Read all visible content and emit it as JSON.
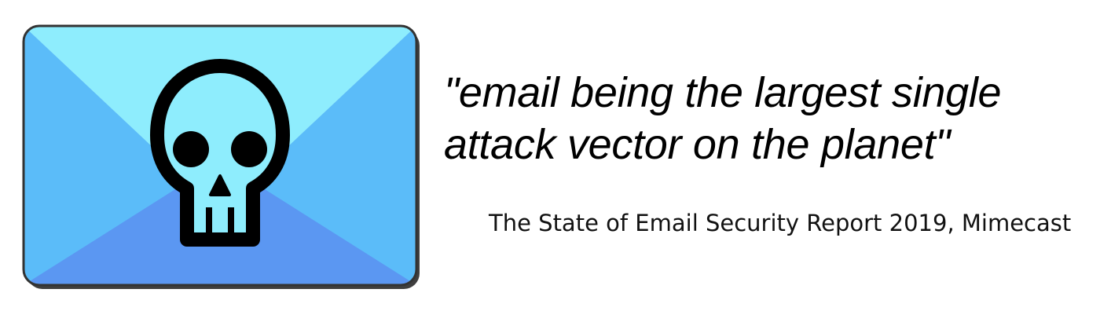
{
  "image": {
    "icon": "email-skull-icon",
    "colors": {
      "envelope_top_flap": "#8eedfd",
      "envelope_side_flaps": "#5bbcf9",
      "envelope_bottom": "#5b97f2",
      "envelope_border": "#333333",
      "skull_fill": "#8eedfd",
      "skull_outline": "#000000"
    }
  },
  "quote": {
    "line1": "\"email being the largest single",
    "line2": "attack vector on the planet\""
  },
  "source": {
    "text": "The State of Email Security Report 2019, Mimecast"
  }
}
